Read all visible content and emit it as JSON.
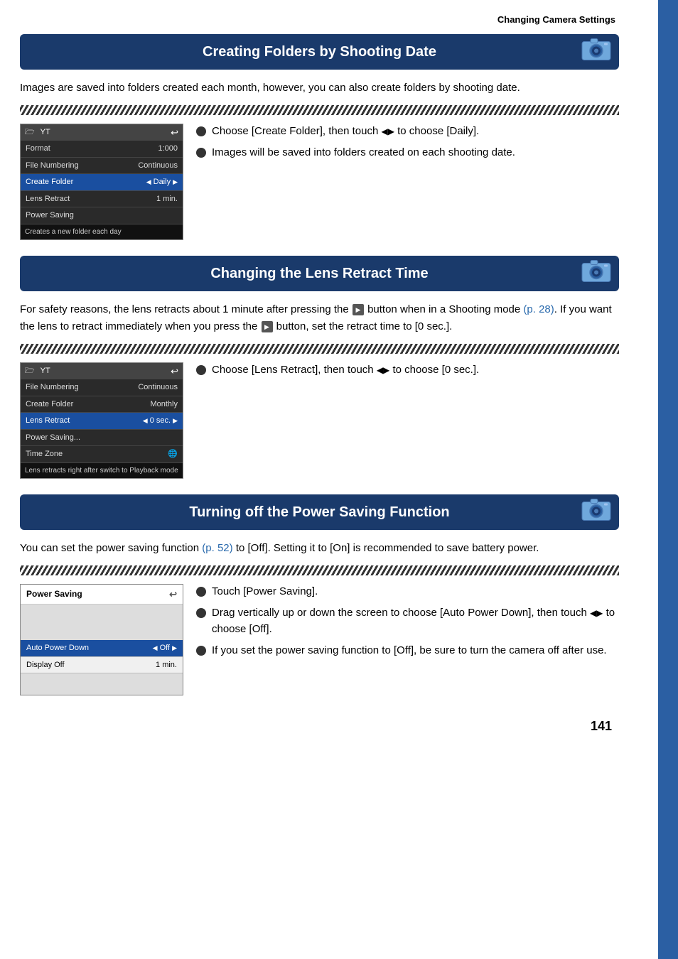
{
  "header": {
    "title": "Changing Camera Settings"
  },
  "page_number": "141",
  "sections": [
    {
      "id": "creating-folders",
      "title": "Creating Folders by Shooting Date",
      "body": "Images are saved into folders created each month, however, you can also create folders by shooting date.",
      "menu": {
        "topbar_icons": [
          "folder",
          "YT",
          "back"
        ],
        "rows": [
          {
            "label": "Format",
            "value": "1:000",
            "highlighted": false
          },
          {
            "label": "File Numbering",
            "value": "Continuous",
            "highlighted": false
          },
          {
            "label": "Create Folder",
            "value": "◀ Daily ▶",
            "highlighted": true
          },
          {
            "label": "Lens Retract",
            "value": "1 min.",
            "highlighted": false
          },
          {
            "label": "Power Saving",
            "value": "",
            "highlighted": false
          }
        ],
        "footer": "Creates a new folder each day"
      },
      "bullets": [
        {
          "text": "Choose [Create Folder], then touch ◀▶ to choose [Daily]."
        },
        {
          "text": "Images will be saved into folders created on each shooting date."
        }
      ]
    },
    {
      "id": "lens-retract",
      "title": "Changing the Lens Retract Time",
      "body_parts": [
        "For safety reasons, the lens retracts about 1 minute after pressing the ",
        "PLAYBACK",
        " button when in a Shooting mode ",
        "(p. 28)",
        ". If you want the lens to retract immediately when you press the ",
        "PLAYBACK",
        " button, set the retract time to [0 sec.]."
      ],
      "menu": {
        "rows": [
          {
            "label": "File Numbering",
            "value": "Continuous",
            "highlighted": false
          },
          {
            "label": "Create Folder",
            "value": "Monthly",
            "highlighted": false
          },
          {
            "label": "Lens Retract",
            "value": "◀ 0 sec. ▶",
            "highlighted": true
          },
          {
            "label": "Power Saving...",
            "value": "",
            "highlighted": false
          },
          {
            "label": "Time Zone",
            "value": "",
            "highlighted": false
          }
        ],
        "footer": "Lens retracts right after switch to Playback mode"
      },
      "bullets": [
        {
          "text": "Choose [Lens Retract], then touch ◀▶ to choose [0 sec.]."
        }
      ]
    },
    {
      "id": "power-saving",
      "title": "Turning off the Power Saving Function",
      "body_parts": [
        "You can set the power saving function ",
        "(p. 52)",
        " to [Off]. Setting it to [On] is recommended to save battery power."
      ],
      "power_menu": {
        "title": "Power Saving",
        "rows": [
          {
            "label": "Auto Power Down",
            "value": "◀ Off ▶",
            "highlighted": true
          },
          {
            "label": "Display Off",
            "value": "1 min.",
            "highlighted": false
          }
        ]
      },
      "bullets": [
        {
          "text": "Touch [Power Saving]."
        },
        {
          "text": "Drag vertically up or down the screen to choose [Auto Power Down], then touch ◀▶ to choose [Off]."
        },
        {
          "text": "If you set the power saving function to [Off], be sure to turn the camera off after use."
        }
      ]
    }
  ]
}
